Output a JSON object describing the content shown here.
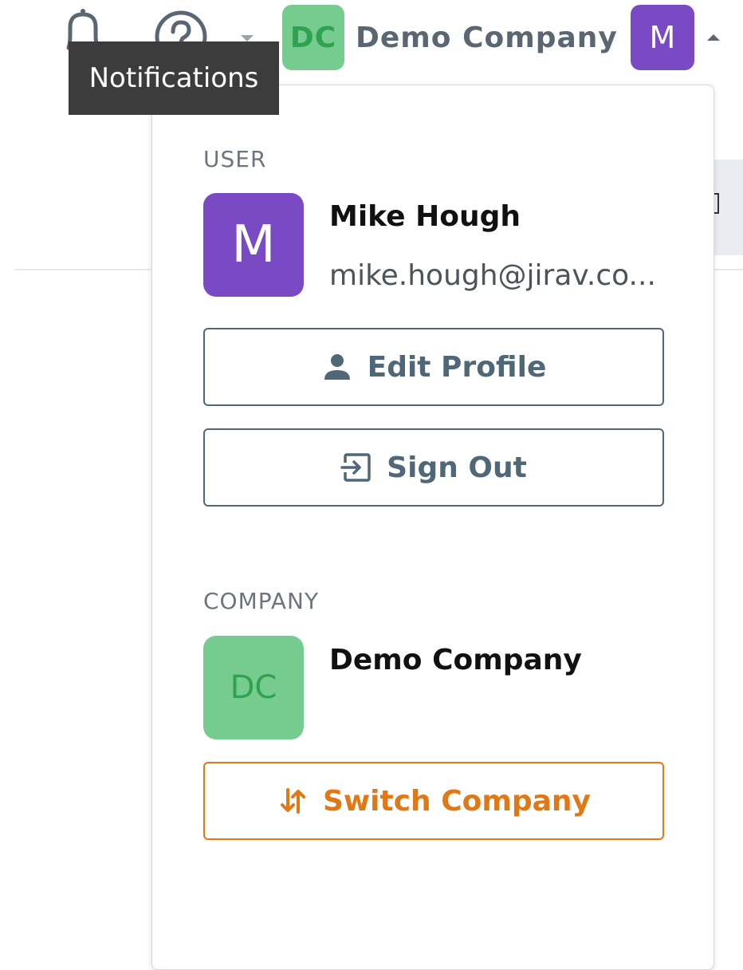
{
  "topbar": {
    "notifications_icon": "bell-icon",
    "help_icon": "question-circle-icon",
    "company_initials": "DC",
    "company_name": "Demo Company",
    "user_initial": "M"
  },
  "tooltip": {
    "text": "Notifications"
  },
  "dropdown": {
    "user_section_label": "USER",
    "user_initial": "M",
    "user_name": "Mike Hough",
    "user_email": "mike.hough@jirav.co...",
    "edit_profile_label": "Edit Profile",
    "sign_out_label": "Sign Out",
    "company_section_label": "COMPANY",
    "company_initials": "DC",
    "company_name": "Demo Company",
    "switch_company_label": "Switch Company"
  },
  "colors": {
    "user_avatar": "#7a4ac4",
    "company_avatar": "#76cc8e",
    "company_initials": "#2ea24f",
    "button_outline": "#4f6776",
    "switch_accent": "#e07816",
    "tooltip_bg": "#3c3c3c"
  }
}
